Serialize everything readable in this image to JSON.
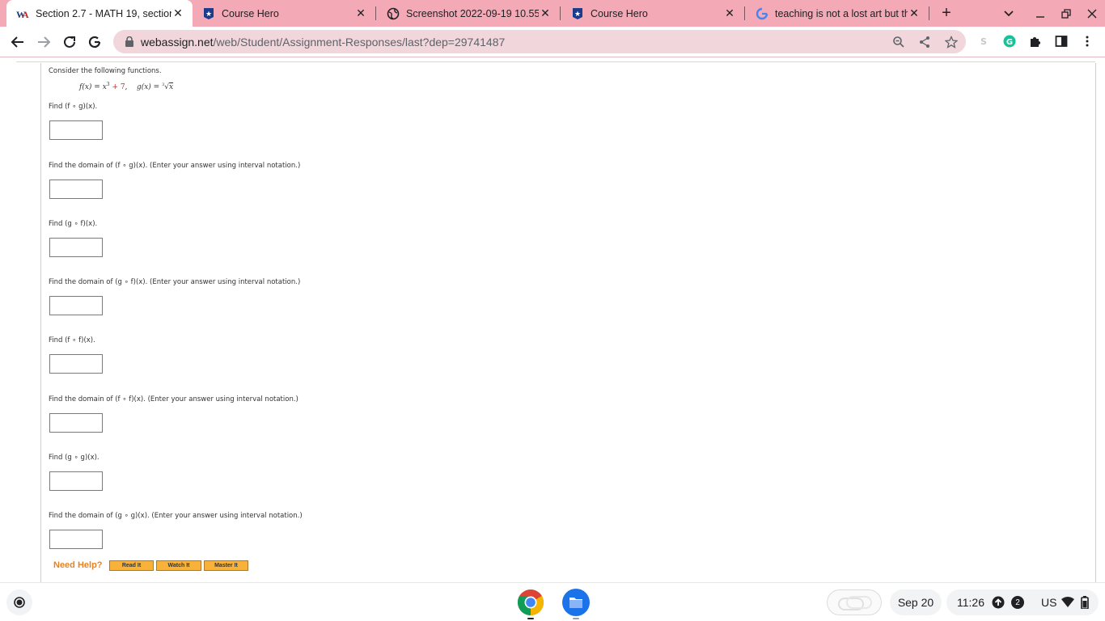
{
  "browser": {
    "tabs": [
      {
        "title": "Section 2.7 - MATH 19, section",
        "favicon": "webassign-icon",
        "active": true
      },
      {
        "title": "Course Hero",
        "favicon": "coursehero-icon",
        "active": false
      },
      {
        "title": "Screenshot 2022-09-19 10.55.",
        "favicon": "globe-icon",
        "active": false
      },
      {
        "title": "Course Hero",
        "favicon": "coursehero-icon",
        "active": false
      },
      {
        "title": "teaching is not a lost art but th",
        "favicon": "google-icon",
        "active": false
      }
    ],
    "url_host": "webassign.net",
    "url_path": "/web/Student/Assignment-Responses/last?dep=29741487",
    "extensions": [
      "s-extension-icon",
      "grammarly-icon",
      "puzzle-icon",
      "sidepanel-icon",
      "kebab-menu-icon"
    ],
    "colors": {
      "tabstrip": "#f4a9b6",
      "omnibox": "#f1d6db"
    }
  },
  "question": {
    "intro": "Consider the following functions.",
    "func_f": "f(x) = x",
    "func_f_exp": "3",
    "func_f_const": "+ 7",
    "func_g": "g(x) = ",
    "func_g_index": "3",
    "func_g_radicand": "x",
    "prompts": [
      "Find  (f ∘ g)(x).",
      "Find the domain of  (f ∘ g)(x).  (Enter your answer using interval notation.)",
      "Find  (g ∘ f)(x).",
      "Find the domain of  (g ∘ f)(x).  (Enter your answer using interval notation.)",
      "Find  (f ∘ f)(x).",
      "Find the domain of  (f ∘ f)(x).  (Enter your answer using interval notation.)",
      "Find  (g ∘ g)(x).",
      "Find the domain of  (g ∘ g)(x).  (Enter your answer using interval notation.)"
    ]
  },
  "help": {
    "label": "Need Help?",
    "buttons": [
      "Read It",
      "Watch It",
      "Master It"
    ]
  },
  "shelf": {
    "date": "Sep 20",
    "time": "11:26",
    "notifications": "2",
    "locale": "US",
    "apps": [
      "chrome-icon",
      "files-icon"
    ]
  }
}
